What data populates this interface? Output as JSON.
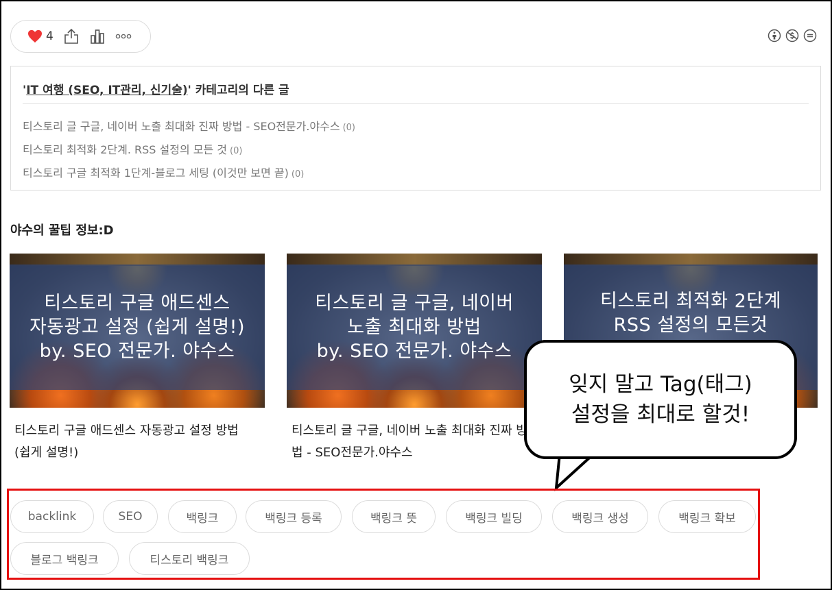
{
  "reaction": {
    "like_count": "4"
  },
  "category": {
    "heading_link": "IT 여행 (SEO, IT관리, 신기술)",
    "heading_prefix": "'",
    "heading_suffix": "' 카테고리의 다른 글",
    "posts": [
      {
        "title": "티스토리 글 구글, 네이버 노출 최대화 진짜 방법 - SEO전문가.야수스",
        "count": "(0)"
      },
      {
        "title": "티스토리 최적화 2단계. RSS 설정의 모든 것",
        "count": "(0)"
      },
      {
        "title": "티스토리 구글 최적화 1단계-블로그 세팅 (이것만 보면 끝)",
        "count": "(0)"
      }
    ]
  },
  "related": {
    "title": "야수의 꿀팁 정보:D",
    "cards": [
      {
        "thumb_lines": [
          "티스토리 구글 애드센스",
          "자동광고 설정 (쉽게 설명!)",
          "by. SEO 전문가. 야수스"
        ],
        "title": "티스토리 구글 애드센스 자동광고 설정 방법 (쉽게 설명!)"
      },
      {
        "thumb_lines": [
          "티스토리 글 구글, 네이버",
          "노출 최대화 방법",
          "by. SEO 전문가. 야수스"
        ],
        "title": "티스토리 글 구글, 네이버 노출 최대화 진짜 방법 - SEO전문가.야수스"
      },
      {
        "thumb_lines": [
          "티스토리 최적화 2단계",
          "RSS 설정의 모든것",
          ""
        ],
        "title": ""
      }
    ]
  },
  "tags": [
    "backlink",
    "SEO",
    "백링크",
    "백링크 등록",
    "백링크 뜻",
    "백링크 빌딩",
    "백링크 생성",
    "백링크 확보",
    "블로그 백링크",
    "티스토리 백링크"
  ],
  "callout": {
    "line1": "잊지 말고 Tag(태그)",
    "line2": "설정을 최대로 할것!"
  },
  "colors": {
    "accent_red": "#e51010",
    "heart": "#ef3535",
    "overlay_blue": "#2c4476"
  }
}
